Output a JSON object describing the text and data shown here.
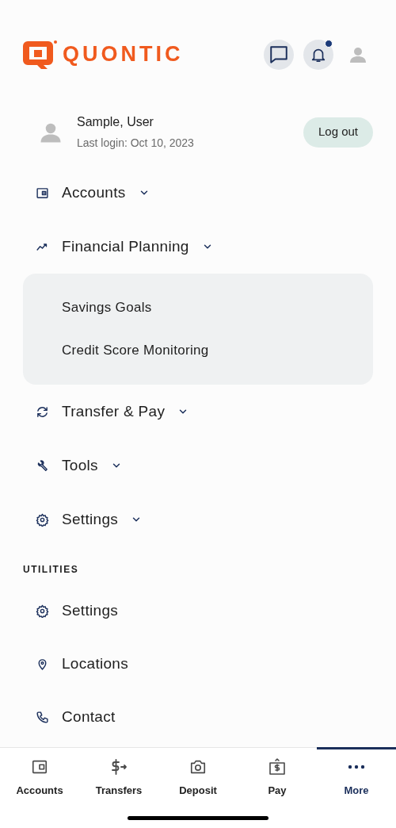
{
  "header": {
    "logo_text": "QUONTIC",
    "notification": true
  },
  "user": {
    "name": "Sample, User",
    "last_login": "Last login: Oct 10, 2023",
    "logout": "Log out"
  },
  "menu": [
    {
      "label": "Accounts"
    },
    {
      "label": "Financial Planning",
      "children": [
        {
          "label": "Savings Goals"
        },
        {
          "label": "Credit Score Monitoring"
        }
      ]
    },
    {
      "label": "Transfer & Pay"
    },
    {
      "label": "Tools"
    },
    {
      "label": "Settings"
    }
  ],
  "utilities": {
    "heading": "UTILITIES",
    "items": [
      {
        "label": "Settings"
      },
      {
        "label": "Locations"
      },
      {
        "label": "Contact"
      }
    ]
  },
  "tab_bar": [
    {
      "label": "Accounts",
      "selected": false
    },
    {
      "label": "Transfers",
      "selected": false
    },
    {
      "label": "Deposit",
      "selected": false
    },
    {
      "label": "Pay",
      "selected": false
    },
    {
      "label": "More",
      "selected": true
    }
  ]
}
